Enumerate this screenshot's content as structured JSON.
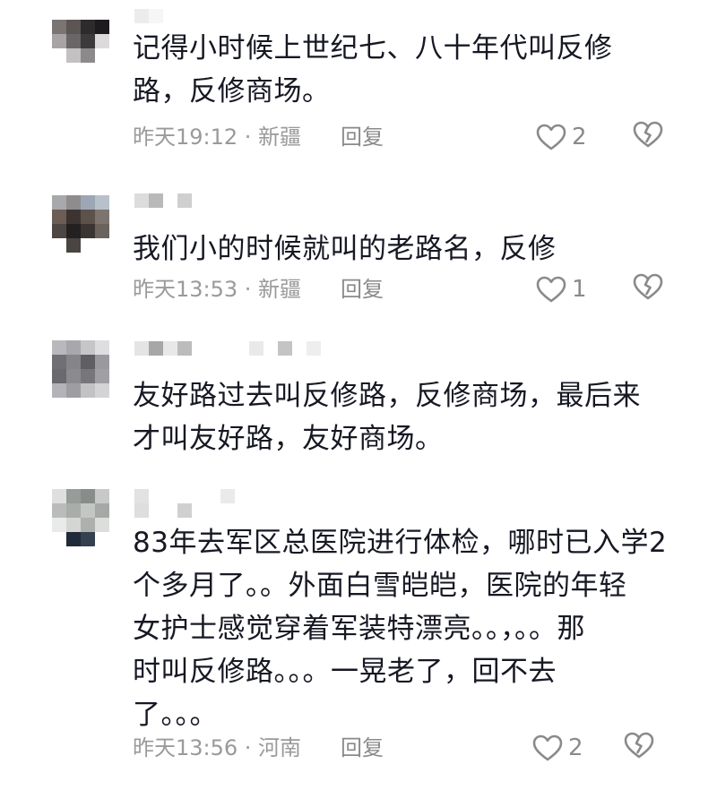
{
  "comments": [
    {
      "text": "记得小时候上世纪七、八十年代叫反修\n路，反修商场。",
      "time": "昨天19:12 · 新疆",
      "reply_label": "回复",
      "like_count": "2",
      "like_icon": "heart-outline-icon",
      "dislike_icon": "broken-heart-icon"
    },
    {
      "text": "我们小的时候就叫的老路名，反修",
      "time": "昨天13:53 · 新疆",
      "reply_label": "回复",
      "like_count": "1",
      "like_icon": "heart-outline-icon",
      "dislike_icon": "broken-heart-icon"
    },
    {
      "text": "友好路过去叫反修路，反修商场，最后来\n才叫友好路，友好商场。",
      "time": "",
      "reply_label": "",
      "like_count": "",
      "like_icon": "",
      "dislike_icon": ""
    },
    {
      "text": "83年去军区总医院进行体检，哪时已入学2\n个多月了。。外面白雪皑皑，医院的年轻\n女护士感觉穿着军装特漂亮。。，。。那\n时叫反修路。。。一晃老了，回不去\n了。。。",
      "time": "昨天13:56 · 河南",
      "reply_label": "回复",
      "like_count": "2",
      "like_icon": "heart-outline-icon",
      "dislike_icon": "broken-heart-icon"
    }
  ],
  "colors": {
    "text": "#161823",
    "meta": "#9a9a9a",
    "icon": "#8a8a8a"
  }
}
